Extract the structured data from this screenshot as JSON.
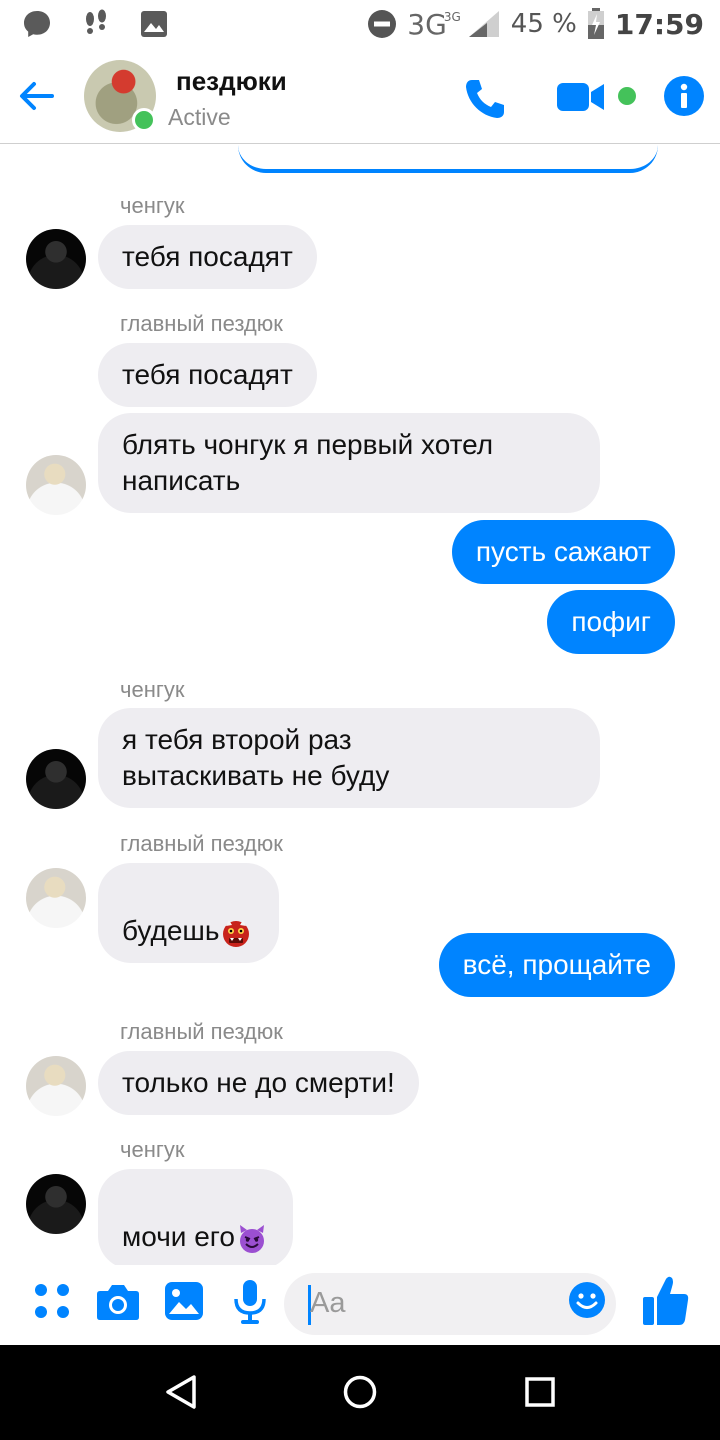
{
  "status_bar": {
    "network": "3G",
    "network_sup": "3G",
    "battery": "45 %",
    "time": "17:59",
    "icons": [
      "messenger-chat-icon",
      "footprints-icon",
      "gallery-icon",
      "do-not-disturb-icon",
      "signal-icon",
      "battery-icon"
    ]
  },
  "header": {
    "title": "пездюки",
    "status": "Active",
    "icons": [
      "back-arrow-icon",
      "phone-icon",
      "video-camera-icon",
      "info-icon"
    ]
  },
  "messages": [
    {
      "id": 1,
      "direction": "in",
      "sender": "ченгук",
      "text": "тебя посадят",
      "avatar": "dark"
    },
    {
      "id": 2,
      "direction": "in",
      "sender": "главный пездюк",
      "text": "тебя посадят",
      "avatar": "none"
    },
    {
      "id": 3,
      "direction": "in",
      "sender": "",
      "text": "блять чонгук я первый хотел\nнаписать",
      "avatar": "light"
    },
    {
      "id": 4,
      "direction": "out",
      "text": "пусть сажают"
    },
    {
      "id": 5,
      "direction": "out",
      "text": "пофиг"
    },
    {
      "id": 6,
      "direction": "in",
      "sender": "ченгук",
      "text": "я тебя второй раз\nвытаскивать не буду",
      "avatar": "dark"
    },
    {
      "id": 7,
      "direction": "in",
      "sender": "главный пездюк",
      "text": "будешь",
      "emoji": "ogre-emoji",
      "avatar": "light"
    },
    {
      "id": 8,
      "direction": "out",
      "text": "всё, прощайте"
    },
    {
      "id": 9,
      "direction": "in",
      "sender": "главный пездюк",
      "text": "только не до смерти!",
      "avatar": "light"
    },
    {
      "id": 10,
      "direction": "in",
      "sender": "ченгук",
      "text": "мочи его",
      "emoji": "smiling-devil-emoji",
      "avatar": "dark"
    }
  ],
  "composer": {
    "placeholder": "Aa",
    "icons": [
      "menu-dots-icon",
      "camera-icon",
      "image-icon",
      "microphone-icon",
      "emoji-icon",
      "thumbs-up-icon"
    ]
  },
  "colors": {
    "accent": "#0084ff",
    "incoming_bubble": "#eeedf1",
    "online": "#44c25a",
    "meta_text": "#8a8a8a"
  }
}
